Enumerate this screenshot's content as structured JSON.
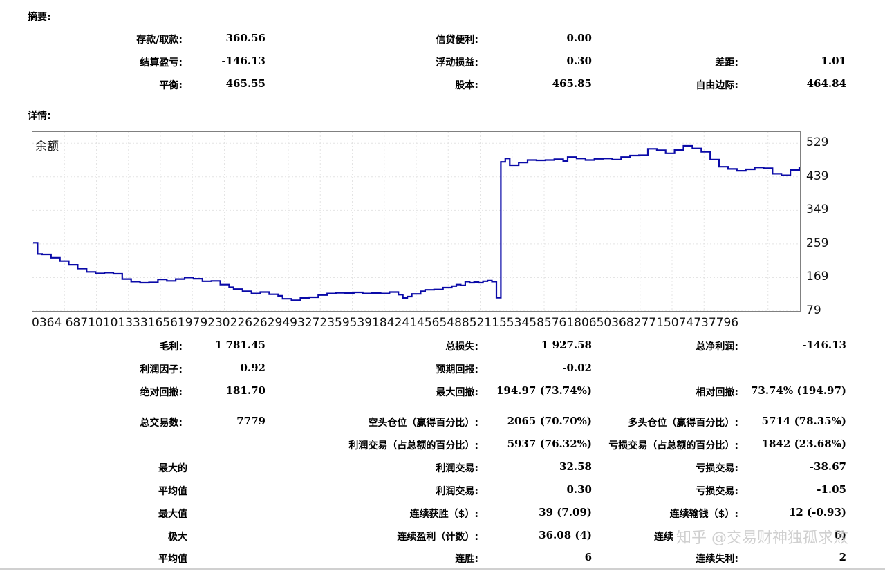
{
  "sections": {
    "summary": "摘要:",
    "details": "详情:"
  },
  "summary": {
    "deposit_withdrawal": {
      "label": "存款/取款:",
      "value": "360.56"
    },
    "credit_facility": {
      "label": "信贷便利:",
      "value": "0.00"
    },
    "closed_pnl": {
      "label": "结算盈亏:",
      "value": "-146.13"
    },
    "floating_pnl": {
      "label": "浮动损益:",
      "value": "0.30"
    },
    "spread": {
      "label": "差距:",
      "value": "1.01"
    },
    "balance": {
      "label": "平衡:",
      "value": "465.55"
    },
    "equity": {
      "label": "股本:",
      "value": "465.85"
    },
    "free_margin": {
      "label": "自由边际:",
      "value": "464.84"
    }
  },
  "chart": {
    "title": "余额",
    "x_tick_labels": "0364   687101013331656197923022626294932723595391842414565488521155345857618065036827715074737796",
    "y_tick_labels": [
      "529",
      "439",
      "349",
      "259",
      "169",
      "79"
    ]
  },
  "chart_data": {
    "type": "line",
    "title": "余额",
    "ylim": [
      79,
      559
    ],
    "yticks": [
      79,
      169,
      259,
      349,
      439,
      529
    ],
    "grid": true,
    "series": [
      {
        "color": "#0a0aa8",
        "points": [
          [
            0,
            262
          ],
          [
            1,
            232
          ],
          [
            2,
            231
          ],
          [
            4,
            222
          ],
          [
            6,
            213
          ],
          [
            8,
            203
          ],
          [
            10,
            193
          ],
          [
            12,
            184
          ],
          [
            14,
            180
          ],
          [
            16,
            182
          ],
          [
            18,
            179
          ],
          [
            20,
            165
          ],
          [
            22,
            158
          ],
          [
            24,
            155
          ],
          [
            26,
            156
          ],
          [
            28,
            164
          ],
          [
            30,
            160
          ],
          [
            32,
            165
          ],
          [
            34,
            169
          ],
          [
            36,
            166
          ],
          [
            38,
            159
          ],
          [
            40,
            160
          ],
          [
            42,
            150
          ],
          [
            44,
            143
          ],
          [
            45,
            138
          ],
          [
            47,
            132
          ],
          [
            49,
            126
          ],
          [
            51,
            130
          ],
          [
            53,
            124
          ],
          [
            55,
            120
          ],
          [
            56,
            112
          ],
          [
            58,
            108
          ],
          [
            60,
            114
          ],
          [
            62,
            116
          ],
          [
            64,
            122
          ],
          [
            66,
            126
          ],
          [
            68,
            128
          ],
          [
            70,
            127
          ],
          [
            72,
            129
          ],
          [
            74,
            126
          ],
          [
            76,
            127
          ],
          [
            78,
            126
          ],
          [
            80,
            130
          ],
          [
            82,
            123
          ],
          [
            83,
            114
          ],
          [
            84,
            118
          ],
          [
            85,
            125
          ],
          [
            87,
            132
          ],
          [
            88,
            136
          ],
          [
            90,
            137
          ],
          [
            92,
            142
          ],
          [
            94,
            146
          ],
          [
            95,
            150
          ],
          [
            96,
            148
          ],
          [
            97,
            158
          ],
          [
            98,
            155
          ],
          [
            99,
            157
          ],
          [
            100,
            155
          ],
          [
            101,
            159
          ],
          [
            102,
            161
          ],
          [
            103,
            158
          ],
          [
            104,
            115
          ],
          [
            105,
            479
          ],
          [
            106,
            488
          ],
          [
            107,
            470
          ],
          [
            109,
            477
          ],
          [
            111,
            484
          ],
          [
            113,
            483
          ],
          [
            115,
            484
          ],
          [
            117,
            486
          ],
          [
            119,
            481
          ],
          [
            120,
            492
          ],
          [
            122,
            488
          ],
          [
            124,
            484
          ],
          [
            126,
            487
          ],
          [
            128,
            488
          ],
          [
            130,
            485
          ],
          [
            132,
            492
          ],
          [
            134,
            496
          ],
          [
            136,
            497
          ],
          [
            138,
            514
          ],
          [
            140,
            510
          ],
          [
            142,
            502
          ],
          [
            144,
            511
          ],
          [
            146,
            522
          ],
          [
            148,
            515
          ],
          [
            150,
            506
          ],
          [
            152,
            485
          ],
          [
            154,
            466
          ],
          [
            156,
            460
          ],
          [
            158,
            455
          ],
          [
            160,
            459
          ],
          [
            162,
            464
          ],
          [
            164,
            462
          ],
          [
            166,
            447
          ],
          [
            168,
            443
          ],
          [
            170,
            457
          ],
          [
            172,
            466
          ]
        ]
      }
    ]
  },
  "stats": {
    "gross_profit": {
      "label": "毛利:",
      "value": "1 781.45"
    },
    "gross_loss": {
      "label": "总损失:",
      "value": "1 927.58"
    },
    "total_net_profit": {
      "label": "总净利润:",
      "value": "-146.13"
    },
    "profit_factor": {
      "label": "利润因子:",
      "value": "0.92"
    },
    "expected_payoff": {
      "label": "预期回报:",
      "value": "-0.02"
    },
    "absolute_drawdown": {
      "label": "绝对回撤:",
      "value": "181.70"
    },
    "maximal_drawdown": {
      "label": "最大回撤:",
      "value": "194.97 (73.74%)"
    },
    "relative_drawdown": {
      "label": "相对回撤:",
      "value": "73.74% (194.97)"
    },
    "total_trades": {
      "label": "总交易数:",
      "value": "7779"
    },
    "short_positions": {
      "label": "空头仓位（赢得百分比）:",
      "value": "2065 (70.70%)"
    },
    "long_positions": {
      "label": "多头仓位（赢得百分比）:",
      "value": "5714 (78.35%)"
    },
    "profit_trades": {
      "label": "利润交易（占总额的百分比）:",
      "value": "5937 (76.32%)"
    },
    "loss_trades": {
      "label": "亏损交易（占总额的百分比）:",
      "value": "1842 (23.68%)"
    },
    "largest": {
      "label": "最大的",
      "profit_label": "利润交易:",
      "profit_value": "32.58",
      "loss_label": "亏损交易:",
      "loss_value": "-38.67"
    },
    "average": {
      "label": "平均值",
      "profit_label": "利润交易:",
      "profit_value": "0.30",
      "loss_label": "亏损交易:",
      "loss_value": "-1.05"
    },
    "maximum": {
      "label": "最大值",
      "wins_label": "连续获胜（$）:",
      "wins_value": "39 (7.09)",
      "losses_label": "连续输钱（$）:",
      "losses_value": "12 (-0.93)"
    },
    "maximal": {
      "label": "极大",
      "profit_label": "连续盈利（计数）:",
      "profit_value": "36.08 (4)",
      "loss_label": "连续",
      "loss_value": "6)"
    },
    "average_consecutive": {
      "label": "平均值",
      "wins_label": "连胜:",
      "wins_value": "6",
      "losses_label": "连续失利:",
      "losses_value": "2"
    }
  },
  "watermark": "知乎 @交易财神独孤求败"
}
